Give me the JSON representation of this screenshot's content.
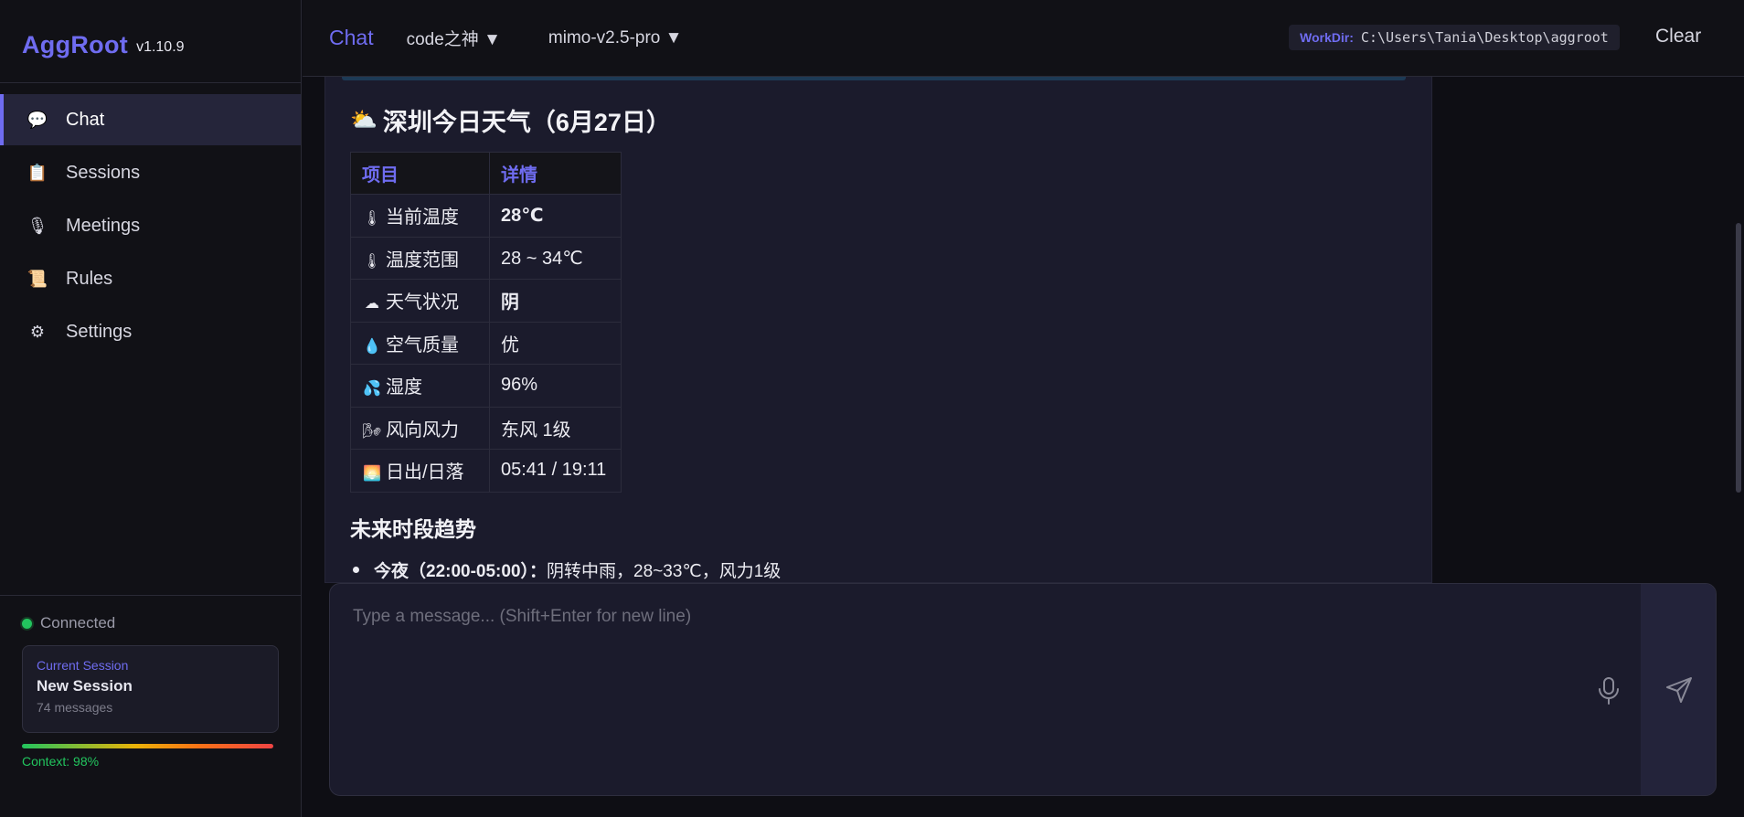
{
  "app": {
    "name": "AggRoot",
    "version": "v1.10.9"
  },
  "nav": [
    {
      "label": "Chat",
      "icon": "chat-bubble-icon",
      "glyph": "💬",
      "active": true
    },
    {
      "label": "Sessions",
      "icon": "clipboard-icon",
      "glyph": "📋",
      "active": false
    },
    {
      "label": "Meetings",
      "icon": "microphone-icon",
      "glyph": "🎙",
      "active": false
    },
    {
      "label": "Rules",
      "icon": "scroll-icon",
      "glyph": "📜",
      "active": false
    },
    {
      "label": "Settings",
      "icon": "gear-icon",
      "glyph": "⚙",
      "active": false
    }
  ],
  "status": {
    "connection": "Connected"
  },
  "session": {
    "label": "Current Session",
    "name": "New Session",
    "count": "74 messages"
  },
  "context": {
    "label": "Context: 98%",
    "percent": 98
  },
  "topbar": {
    "title": "Chat",
    "agent_select": "code之神 ▼",
    "model_select": "mimo-v2.5-pro ▼",
    "workdir_label": "WorkDir:",
    "workdir_path": "C:\\Users\\Tania\\Desktop\\aggroot",
    "clear_label": "Clear"
  },
  "message": {
    "title": "深圳今日天气（6月27日）",
    "title_icon": "⛅",
    "table": {
      "headers": [
        "项目",
        "详情"
      ],
      "rows": [
        {
          "icon": "🌡",
          "label": "当前温度",
          "value": "28℃",
          "bold": true
        },
        {
          "icon": "🌡",
          "label": "温度范围",
          "value": "28 ~ 34℃",
          "bold": false
        },
        {
          "icon": "☁",
          "label": "天气状况",
          "value": "阴",
          "bold": true
        },
        {
          "icon": "💧",
          "label": "空气质量",
          "value": "优",
          "bold": false
        },
        {
          "icon": "💦",
          "label": "湿度",
          "value": "96%",
          "bold": false
        },
        {
          "icon": "🌬",
          "label": "风向风力",
          "value": "东风 1级",
          "bold": false
        },
        {
          "icon": "🌅",
          "label": "日出/日落",
          "value": "05:41 / 19:11",
          "bold": false
        }
      ]
    },
    "trend_heading": "未来时段趋势",
    "trend_items": [
      {
        "period": "今夜（22:00-05:00）：",
        "detail": "阴转中雨，28~33℃，风力1级"
      }
    ]
  },
  "composer": {
    "placeholder": "Type a message... (Shift+Enter for new line)"
  },
  "colors": {
    "accent": "#6f6cf0",
    "connected": "#22c55e",
    "background": "#0e0e14",
    "panel": "#1b1b2c"
  }
}
